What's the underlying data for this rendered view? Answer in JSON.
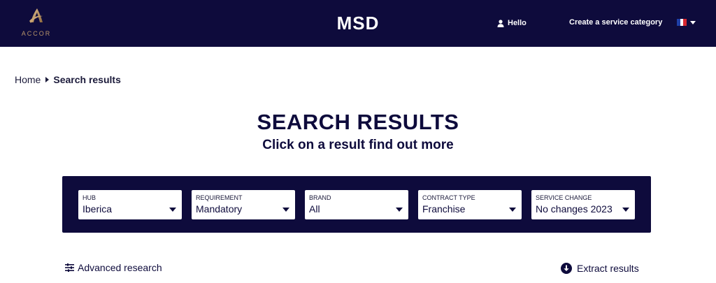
{
  "header": {
    "logo_text": "ACCOR",
    "app_title": "MSD",
    "hello_label": "Hello",
    "create_label": "Create a service category",
    "language_flag": "fr",
    "colors": {
      "background": "#0e0b3c",
      "logo_gold": "#b9956a"
    }
  },
  "breadcrumb": {
    "home": "Home",
    "current": "Search results"
  },
  "page": {
    "title": "SEARCH RESULTS",
    "subtitle": "Click on a result find out more"
  },
  "filters": [
    {
      "label": "HUB",
      "value": "Iberica"
    },
    {
      "label": "REQUIREMENT",
      "value": "Mandatory"
    },
    {
      "label": "BRAND",
      "value": "All"
    },
    {
      "label": "CONTRACT TYPE",
      "value": "Franchise"
    },
    {
      "label": "SERVICE CHANGE",
      "value": "No changes 2023"
    }
  ],
  "actions": {
    "advanced_label": "Advanced research",
    "extract_label": "Extract results"
  },
  "icons": {
    "user": "user-icon",
    "advanced": "sliders-icon",
    "extract": "download-circle-icon"
  }
}
